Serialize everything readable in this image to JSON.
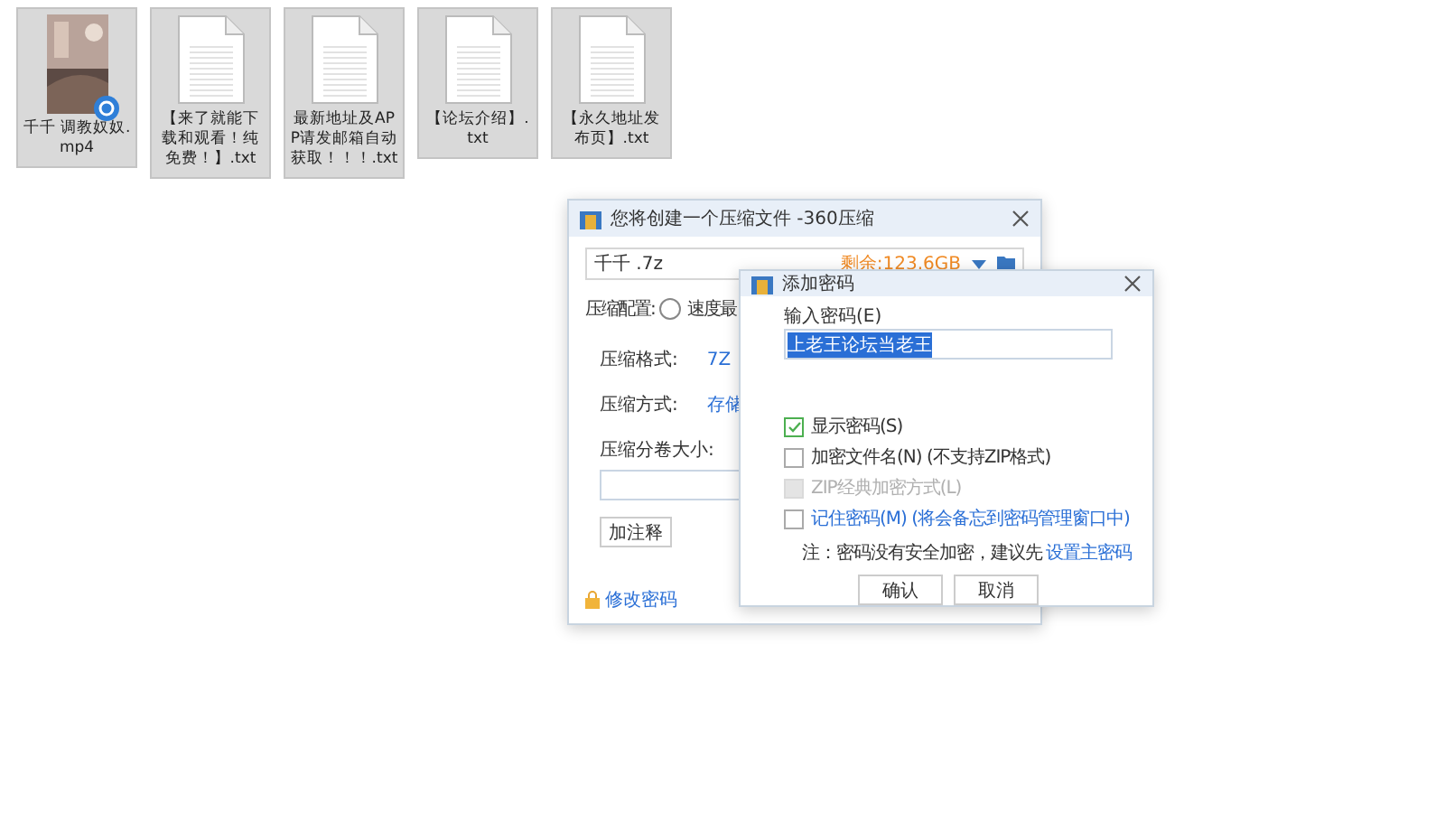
{
  "desktop": {
    "files": [
      {
        "kind": "video",
        "name": "千千  调教奴奴.mp4",
        "selected": true
      },
      {
        "kind": "text",
        "name": "【来了就能下载和观看！纯免费！】.txt",
        "selected": true
      },
      {
        "kind": "text",
        "name": "最新地址及APP请发邮箱自动获取！！！.txt",
        "selected": true
      },
      {
        "kind": "text",
        "name": "【论坛介绍】.txt",
        "selected": true
      },
      {
        "kind": "text",
        "name": "【永久地址发布页】.txt",
        "selected": true
      }
    ]
  },
  "compress_window": {
    "title": "您将创建一个压缩文件 -360压缩",
    "file_name": "千千 .7z",
    "free_space": "剩余:123.6GB",
    "config_label": "压缩配置:",
    "config_option": {
      "label": "速度最",
      "selected": false
    },
    "settings": [
      {
        "label": "压缩格式:",
        "value": "7Z"
      },
      {
        "label": "压缩方式:",
        "value": "存储"
      }
    ],
    "split_label": "压缩分卷大小:",
    "comment_button": "加注释",
    "change_password_link": "修改密码"
  },
  "password_dialog": {
    "title": "添加密码",
    "field_label": "输入密码(E)",
    "password": "上老王论坛当老王",
    "password_selected": true,
    "options": [
      {
        "kind": "plain",
        "label": "显示密码(S)",
        "checked": true,
        "disabled": false
      },
      {
        "kind": "plain",
        "label": "加密文件名(N) (不支持ZIP格式)",
        "checked": false,
        "disabled": false
      },
      {
        "kind": "plain",
        "label": "ZIP经典加密方式(L)",
        "checked": false,
        "disabled": true
      },
      {
        "kind": "link",
        "label": "记住密码(M) (将会备忘到密码管理窗口中)",
        "checked": false,
        "disabled": false
      }
    ],
    "note": "注：密码没有安全加密，建议先",
    "note_link": "设置主密码",
    "buttons": [
      "确认",
      "取消"
    ]
  }
}
